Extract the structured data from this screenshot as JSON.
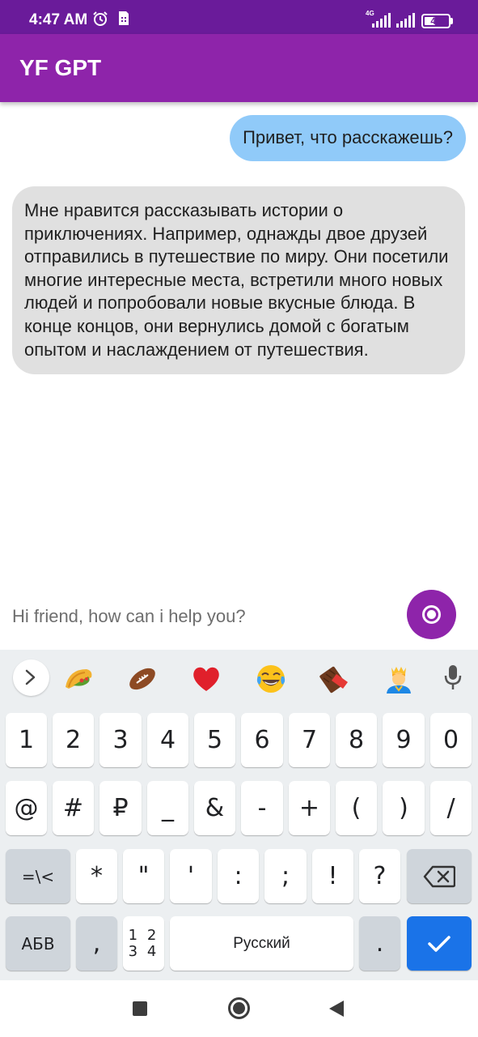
{
  "status_bar": {
    "time": "4:47 AM",
    "network": "4G",
    "battery": "46",
    "battery_level": 0.46
  },
  "app_bar": {
    "title": "YF GPT"
  },
  "chat": {
    "messages": [
      {
        "role": "user",
        "text": "Привет, что расскажешь?"
      },
      {
        "role": "bot",
        "text": "Мне нравится рассказывать истории о приключениях. Например, однажды двое друзей отправились в путешествие по миру. Они посетили многие интересные места, встретили много новых людей и попробовали новые вкусные блюда. В конце концов, они вернулись домой с богатым опытом и наслаждением от путешествия."
      }
    ]
  },
  "input": {
    "placeholder": "Hi friend, how can i help you?"
  },
  "keyboard": {
    "emojis": [
      "taco",
      "american-football",
      "red-heart",
      "face-with-tears-of-joy",
      "chocolate-bar",
      "prince"
    ],
    "rows": [
      [
        "1",
        "2",
        "3",
        "4",
        "5",
        "6",
        "7",
        "8",
        "9",
        "0"
      ],
      [
        "@",
        "#",
        "₽",
        "_",
        "&",
        "-",
        "+",
        "(",
        ")",
        "/"
      ],
      [
        "=\\<",
        "*",
        "\"",
        "'",
        ":",
        ";",
        "!",
        "?"
      ]
    ],
    "abc_key": "АБВ",
    "comma_key": ",",
    "numpad_top": "1 2",
    "numpad_bottom": "3 4",
    "space_label": "Русский",
    "period_key": "."
  },
  "colors": {
    "status_bar": "#6a1b9a",
    "app_bar": "#8e24aa",
    "user_bubble": "#90caf9",
    "bot_bubble": "#e0e0e0",
    "accent": "#1a73e8"
  }
}
